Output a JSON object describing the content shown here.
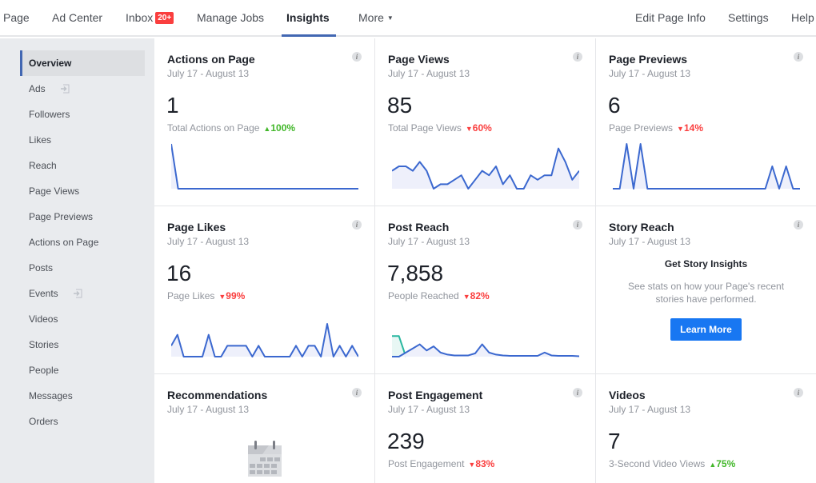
{
  "topnav": {
    "items": [
      {
        "label": "Page"
      },
      {
        "label": "Ad Center"
      },
      {
        "label": "Inbox",
        "badge": "20+"
      },
      {
        "label": "Manage Jobs"
      },
      {
        "label": "Insights",
        "active": true
      },
      {
        "label": "More"
      },
      {
        "label": "Edit Page Info"
      },
      {
        "label": "Settings"
      },
      {
        "label": "Help"
      }
    ]
  },
  "sidebar": {
    "items": [
      {
        "label": "Overview",
        "active": true
      },
      {
        "label": "Ads",
        "icon": "external-arrow-icon"
      },
      {
        "label": "Followers"
      },
      {
        "label": "Likes"
      },
      {
        "label": "Reach"
      },
      {
        "label": "Page Views"
      },
      {
        "label": "Page Previews"
      },
      {
        "label": "Actions on Page"
      },
      {
        "label": "Posts"
      },
      {
        "label": "Events",
        "icon": "external-arrow-icon"
      },
      {
        "label": "Videos"
      },
      {
        "label": "Stories"
      },
      {
        "label": "People"
      },
      {
        "label": "Messages"
      },
      {
        "label": "Orders"
      }
    ]
  },
  "colors": {
    "accent": "#4267b2",
    "line": "#3b68cf",
    "fill": "#eef0fb",
    "up": "#42b72a",
    "down": "#fa3e3e",
    "teal": "#2ab7a0",
    "button": "#1877f2"
  },
  "cards": {
    "actions": {
      "title": "Actions on Page",
      "date": "July 17 - August 13",
      "value": "1",
      "sub": "Total Actions on Page",
      "delta": "100%",
      "direction": "up"
    },
    "views": {
      "title": "Page Views",
      "date": "July 17 - August 13",
      "value": "85",
      "sub": "Total Page Views",
      "delta": "60%",
      "direction": "down"
    },
    "previews": {
      "title": "Page Previews",
      "date": "July 17 - August 13",
      "value": "6",
      "sub": "Page Previews",
      "delta": "14%",
      "direction": "down"
    },
    "likes": {
      "title": "Page Likes",
      "date": "July 17 - August 13",
      "value": "16",
      "sub": "Page Likes",
      "delta": "99%",
      "direction": "down"
    },
    "reach": {
      "title": "Post Reach",
      "date": "July 17 - August 13",
      "value": "7,858",
      "sub": "People Reached",
      "delta": "82%",
      "direction": "down"
    },
    "story": {
      "title": "Story Reach",
      "date": "July 17 - August 13",
      "heading": "Get Story Insights",
      "text": "See stats on how your Page's recent stories have performed.",
      "button": "Learn More"
    },
    "recommendations": {
      "title": "Recommendations",
      "date": "July 17 - August 13",
      "icon": "calendar-icon"
    },
    "engagement": {
      "title": "Post Engagement",
      "date": "July 17 - August 13",
      "value": "239",
      "sub": "Post Engagement",
      "delta": "83%",
      "direction": "down"
    },
    "videos": {
      "title": "Videos",
      "date": "July 17 - August 13",
      "value": "7",
      "sub": "3-Second Video Views",
      "delta": "75%",
      "direction": "up"
    }
  },
  "chart_data": [
    {
      "type": "area",
      "name": "actions",
      "values": [
        1,
        0,
        0,
        0,
        0,
        0,
        0,
        0,
        0,
        0,
        0,
        0,
        0,
        0,
        0,
        0,
        0,
        0,
        0,
        0,
        0,
        0,
        0,
        0,
        0,
        0,
        0,
        0
      ],
      "ylim": [
        0,
        1
      ]
    },
    {
      "type": "area",
      "name": "views",
      "values": [
        4,
        5,
        5,
        4,
        6,
        4,
        0,
        1,
        1,
        2,
        3,
        0,
        2,
        4,
        3,
        5,
        1,
        3,
        0,
        0,
        3,
        2,
        3,
        3,
        9,
        6,
        2,
        4
      ],
      "ylim": [
        0,
        10
      ]
    },
    {
      "type": "area",
      "name": "previews",
      "values": [
        0,
        0,
        2,
        0,
        2,
        0,
        0,
        0,
        0,
        0,
        0,
        0,
        0,
        0,
        0,
        0,
        0,
        0,
        0,
        0,
        0,
        0,
        0,
        1,
        0,
        1,
        0,
        0
      ],
      "ylim": [
        0,
        2
      ]
    },
    {
      "type": "area",
      "name": "likes",
      "values": [
        1,
        2,
        0,
        0,
        0,
        0,
        2,
        0,
        0,
        1,
        1,
        1,
        1,
        0,
        1,
        0,
        0,
        0,
        0,
        0,
        1,
        0,
        1,
        1,
        0,
        3,
        0,
        1,
        0,
        1,
        0
      ],
      "ylim": [
        0,
        3
      ]
    },
    {
      "type": "area",
      "name": "reach",
      "series": [
        {
          "name": "organic",
          "values": [
            0,
            0,
            1,
            2,
            3,
            1.5,
            2.5,
            1,
            0.5,
            0.3,
            0.3,
            0.3,
            0.8,
            3,
            1,
            0.5,
            0.3,
            0.2,
            0.2,
            0.2,
            0.2,
            0.2,
            1,
            0.3,
            0.2,
            0.2,
            0.2,
            0.1
          ]
        },
        {
          "name": "paid",
          "values": [
            5,
            5,
            0
          ]
        }
      ],
      "ylim": [
        0,
        7
      ]
    }
  ]
}
